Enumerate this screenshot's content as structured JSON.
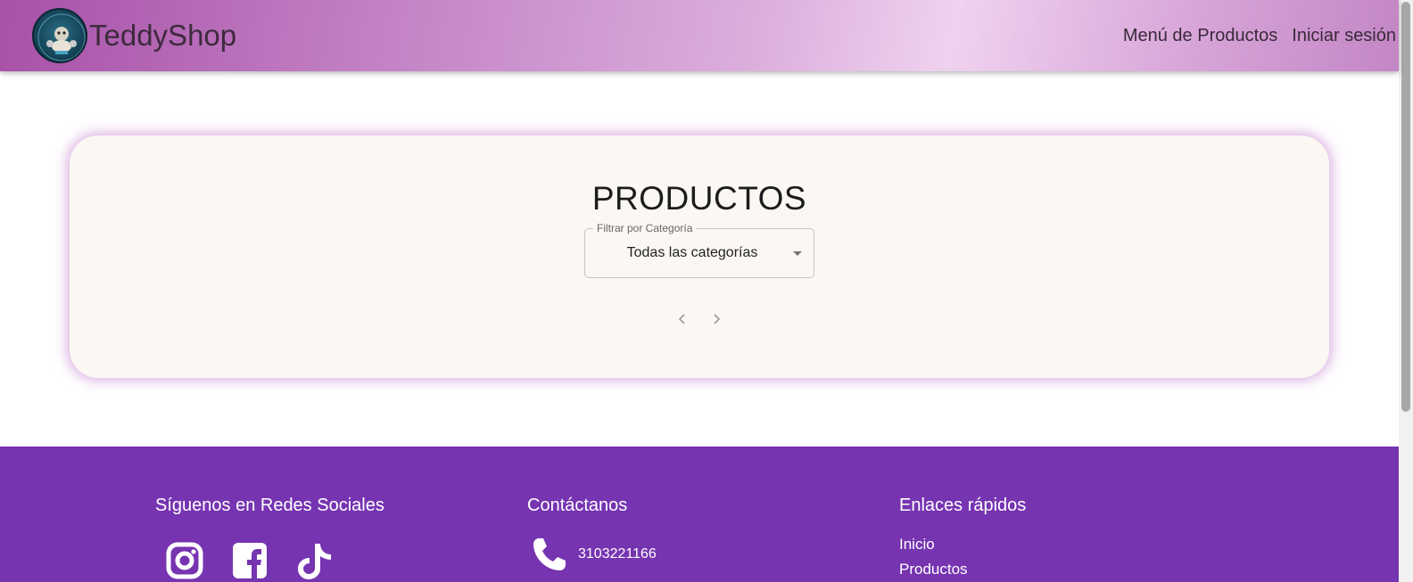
{
  "header": {
    "brand": "TeddyShop",
    "nav": [
      "Menú de Productos",
      "Iniciar sesión"
    ]
  },
  "products": {
    "title": "PRODUCTOS",
    "filter": {
      "label": "Filtrar por Categoría",
      "selected": "Todas las categorías"
    },
    "pager": {
      "prev_icon": "chevron-left-icon",
      "next_icon": "chevron-right-icon"
    }
  },
  "footer": {
    "social": {
      "title": "Síguenos en Redes Sociales",
      "icons": [
        "instagram-icon",
        "facebook-icon",
        "tiktok-icon"
      ]
    },
    "contact": {
      "title": "Contáctanos",
      "phone": "3103221166"
    },
    "links": {
      "title": "Enlaces rápidos",
      "items": [
        "Inicio",
        "Productos"
      ]
    }
  },
  "colors": {
    "footer_bg": "#7634b1",
    "card_bg": "#fbf8f3",
    "card_glow": "#be6ec8"
  }
}
